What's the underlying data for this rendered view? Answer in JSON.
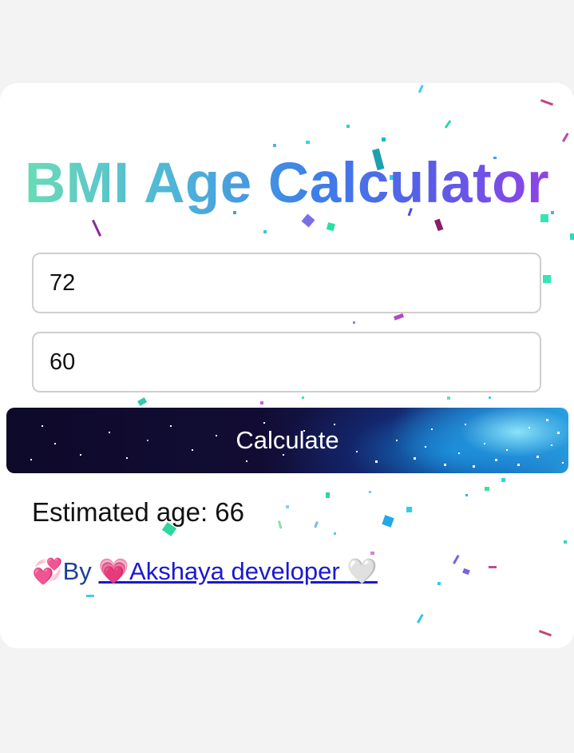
{
  "app": {
    "title": "BMI Age Calculator"
  },
  "form": {
    "weight_value": "72",
    "height_value": "60",
    "calculate_label": "Calculate"
  },
  "result": {
    "text": "Estimated age: 66"
  },
  "credit": {
    "prefix_emoji": "💞",
    "by_label": "By ",
    "link_emoji_left": "💗",
    "link_text": "Akshaya developer ",
    "link_emoji_right": "🤍"
  },
  "colors": {
    "title_gradient": [
      "#6ee2b0",
      "#4fb6d8",
      "#3d7fe8",
      "#5a5ce8",
      "#9a3ee6"
    ],
    "button_dark": "#0e0a2a",
    "button_accent": "#2ab0e4",
    "link": "#1a1ad0"
  }
}
